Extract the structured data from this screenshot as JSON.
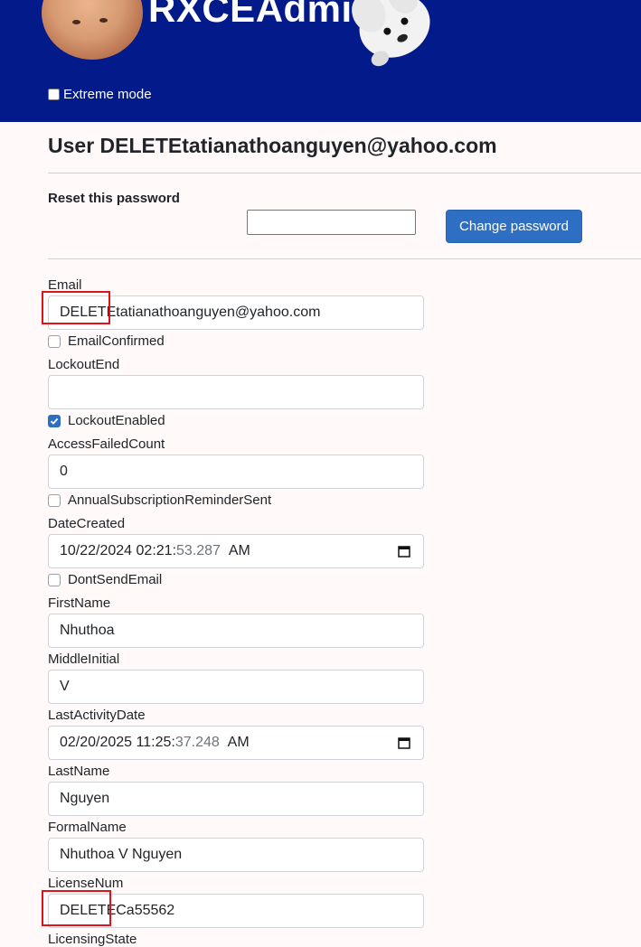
{
  "header": {
    "app_title": "RXCEAdmin",
    "extreme_mode_label": "Extreme mode",
    "extreme_mode_checked": false,
    "background_color": "#021a8a"
  },
  "page": {
    "title": "User DELETEtatianathoanguyen@yahoo.com"
  },
  "password": {
    "reset_label": "Reset this password",
    "input_value": "",
    "button_label": "Change password"
  },
  "fields": {
    "email": {
      "label": "Email",
      "value": "DELETEtatianathoanguyen@yahoo.com"
    },
    "email_confirmed": {
      "label": "EmailConfirmed",
      "checked": false
    },
    "lockout_end": {
      "label": "LockoutEnd",
      "value": ""
    },
    "lockout_enabled": {
      "label": "LockoutEnabled",
      "checked": true
    },
    "access_failed_count": {
      "label": "AccessFailedCount",
      "value": "0"
    },
    "annual_subscription_reminder_sent": {
      "label": "AnnualSubscriptionReminderSent",
      "checked": false
    },
    "date_created": {
      "label": "DateCreated",
      "value_main": "10/22/2024 02:21:",
      "value_dim": "53.287",
      "value_ampm": "AM"
    },
    "dont_send_email": {
      "label": "DontSendEmail",
      "checked": false
    },
    "first_name": {
      "label": "FirstName",
      "value": "Nhuthoa"
    },
    "middle_initial": {
      "label": "MiddleInitial",
      "value": "V"
    },
    "last_activity_date": {
      "label": "LastActivityDate",
      "value_main": "02/20/2025 11:25:",
      "value_dim": "37.248",
      "value_ampm": "AM"
    },
    "last_name": {
      "label": "LastName",
      "value": "Nguyen"
    },
    "formal_name": {
      "label": "FormalName",
      "value": "Nhuthoa V Nguyen"
    },
    "license_num": {
      "label": "LicenseNum",
      "value": "DELETECa55562"
    },
    "licensing_state": {
      "label": "LicensingState"
    }
  },
  "colors": {
    "accent_button": "#2f6fc3",
    "highlight_box": "#e0121a"
  }
}
